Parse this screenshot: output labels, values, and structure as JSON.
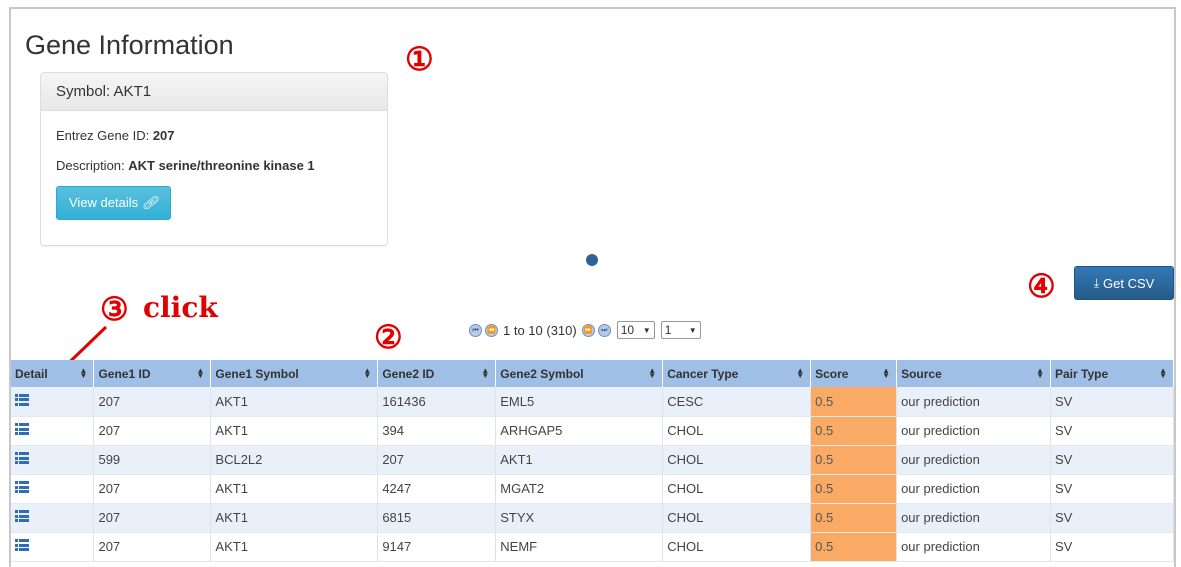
{
  "title": "Gene Information",
  "gene_panel": {
    "symbol": "Symbol: AKT1",
    "entrez_label": "Entrez Gene ID: ",
    "entrez_value": "207",
    "description_label": "Description: ",
    "description_value": "AKT serine/threonine kinase 1",
    "view_details": "View details"
  },
  "annotations": {
    "a1": "①",
    "a2": "②",
    "a3": "③",
    "a4": "④",
    "click": "click"
  },
  "get_csv": "Get CSV",
  "pager": {
    "range": "1 to 10 (310)",
    "page_size": "10",
    "page_number": "1"
  },
  "columns": [
    "Detail",
    "Gene1 ID",
    "Gene1 Symbol",
    "Gene2 ID",
    "Gene2 Symbol",
    "Cancer Type",
    "Score",
    "Source",
    "Pair Type"
  ],
  "rows": [
    [
      "207",
      "AKT1",
      "161436",
      "EML5",
      "CESC",
      "0.5",
      "our prediction",
      "SV"
    ],
    [
      "207",
      "AKT1",
      "394",
      "ARHGAP5",
      "CHOL",
      "0.5",
      "our prediction",
      "SV"
    ],
    [
      "599",
      "BCL2L2",
      "207",
      "AKT1",
      "CHOL",
      "0.5",
      "our prediction",
      "SV"
    ],
    [
      "207",
      "AKT1",
      "4247",
      "MGAT2",
      "CHOL",
      "0.5",
      "our prediction",
      "SV"
    ],
    [
      "207",
      "AKT1",
      "6815",
      "STYX",
      "CHOL",
      "0.5",
      "our prediction",
      "SV"
    ],
    [
      "207",
      "AKT1",
      "9147",
      "NEMF",
      "CHOL",
      "0.5",
      "our prediction",
      "SV"
    ]
  ],
  "colors": {
    "header_bg": "#a0bfe6",
    "score_bg": "#f9ab66",
    "annotation": "#e00000",
    "primary": "#337ab7",
    "info": "#5bc0de"
  }
}
